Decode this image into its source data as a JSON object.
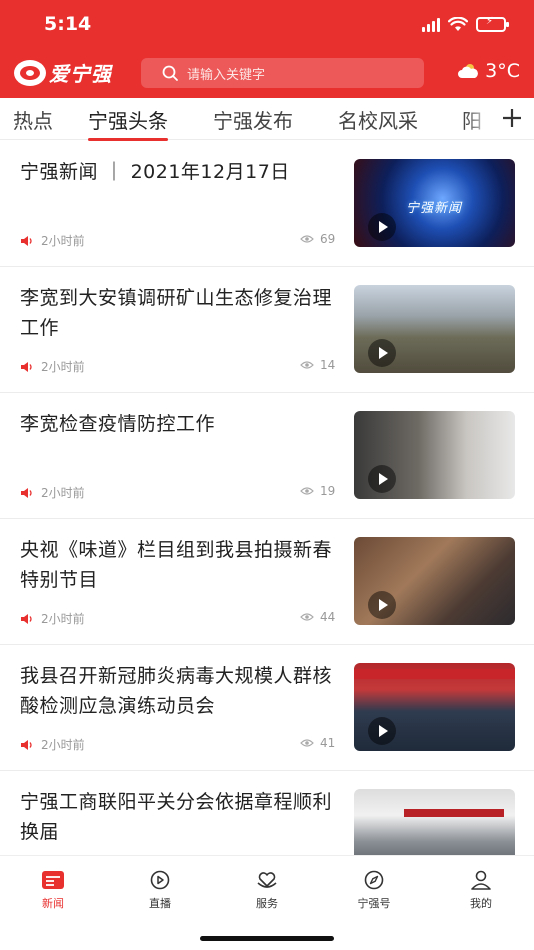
{
  "status_bar": {
    "time": "5:14"
  },
  "header": {
    "logo_text": "爱宁强",
    "search_placeholder": "请输入关键字",
    "weather_temp": "3°C",
    "accent_color": "#e8302f"
  },
  "tabs": [
    {
      "label": "热点",
      "active": false
    },
    {
      "label": "宁强头条",
      "active": true
    },
    {
      "label": "宁强发布",
      "active": false
    },
    {
      "label": "名校风采",
      "active": false
    },
    {
      "label": "阳",
      "active": false
    }
  ],
  "news": [
    {
      "title": "宁强新闻 ｜ 2021年12月17日",
      "time": "2小时前",
      "views": "69",
      "thumb_caption": "宁强新闻"
    },
    {
      "title": "李宽到大安镇调研矿山生态修复治理工作",
      "time": "2小时前",
      "views": "14"
    },
    {
      "title": "李宽检查疫情防控工作",
      "time": "2小时前",
      "views": "19"
    },
    {
      "title": "央视《味道》栏目组到我县拍摄新春特别节目",
      "time": "2小时前",
      "views": "44"
    },
    {
      "title": "我县召开新冠肺炎病毒大规模人群核酸检测应急演练动员会",
      "time": "2小时前",
      "views": "41"
    },
    {
      "title": "宁强工商联阳平关分会依据章程顺利换届",
      "time": "",
      "views": ""
    }
  ],
  "bottom_nav": [
    {
      "label": "新闻",
      "icon": "news-icon",
      "active": true
    },
    {
      "label": "直播",
      "icon": "live-icon",
      "active": false
    },
    {
      "label": "服务",
      "icon": "service-icon",
      "active": false
    },
    {
      "label": "宁强号",
      "icon": "compass-icon",
      "active": false
    },
    {
      "label": "我的",
      "icon": "profile-icon",
      "active": false
    }
  ]
}
